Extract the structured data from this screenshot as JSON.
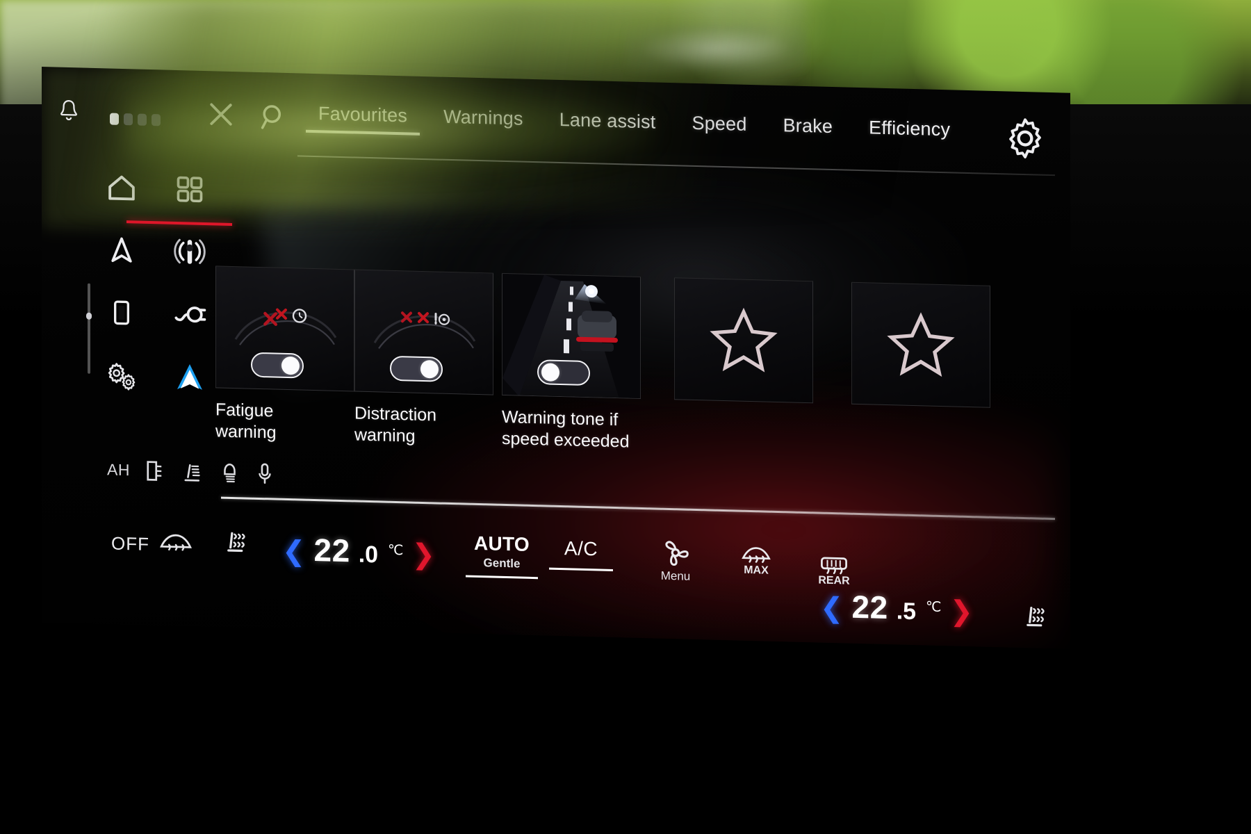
{
  "topbar": {
    "notifications_icon": "bell-icon",
    "pagination": {
      "total": 4,
      "active_index": 0
    },
    "close_label": "close-icon",
    "search_label": "search-icon",
    "settings_label": "gear-icon",
    "tabs": [
      {
        "label": "Favourites",
        "active": true
      },
      {
        "label": "Warnings",
        "active": false
      },
      {
        "label": "Lane assist",
        "active": false
      },
      {
        "label": "Speed",
        "active": false
      },
      {
        "label": "Brake",
        "active": false
      },
      {
        "label": "Efficiency",
        "active": false
      }
    ]
  },
  "sidebar": {
    "items": [
      {
        "name": "home-icon",
        "label": "Home",
        "active": true
      },
      {
        "name": "apps-grid-icon",
        "label": "Apps",
        "active": true
      },
      {
        "name": "navigation-arrow-icon",
        "label": "Navigation",
        "active": false
      },
      {
        "name": "radio-antenna-icon",
        "label": "Radio",
        "active": false
      },
      {
        "name": "phone-icon",
        "label": "Phone",
        "active": false
      },
      {
        "name": "charging-plug-icon",
        "label": "Charging",
        "active": false
      },
      {
        "name": "settings-gears-icon",
        "label": "Settings",
        "active": false
      },
      {
        "name": "maps-navigation-icon",
        "label": "Maps",
        "active": false
      }
    ],
    "accent_color": "#e2142a"
  },
  "status_row": {
    "text": "AH",
    "icons": [
      "door-open-icon",
      "seat-adjust-icon",
      "headrest-icon",
      "microphone-icon"
    ]
  },
  "favourites": {
    "cards": [
      {
        "label": "Fatigue\nwarning",
        "label_line1": "Fatigue",
        "label_line2": "warning",
        "toggle_state": "on",
        "artwork": "driver-fatigue-coffee-icon"
      },
      {
        "label": "Distraction\nwarning",
        "label_line1": "Distraction",
        "label_line2": "warning",
        "toggle_state": "on",
        "artwork": "driver-distraction-icon"
      },
      {
        "label": "Warning tone if\nspeed exceeded",
        "label_line1": "Warning tone if",
        "label_line2": "speed exceeded",
        "toggle_state": "off",
        "artwork": "road-speed-camera-icon"
      }
    ],
    "empty_slots": [
      {
        "icon": "star-outline-icon"
      },
      {
        "icon": "star-outline-icon"
      }
    ]
  },
  "climate": {
    "off_label": "OFF",
    "windscreen_icon": "windscreen-defrost-icon",
    "seat_heat_icon": "seat-heater-icon",
    "left_temp": {
      "integer": "22",
      "decimal": ".0",
      "unit": "℃",
      "dec_left": "❮",
      "dec_right": "❯"
    },
    "right_temp": {
      "integer": "22",
      "decimal": ".5",
      "unit": "℃",
      "dec_left": "❮",
      "dec_right": "❯"
    },
    "auto": {
      "main": "AUTO",
      "sub": "Gentle",
      "active": true
    },
    "ac": {
      "main": "A/C",
      "active": true
    },
    "fan": {
      "icon": "fan-icon",
      "caption": "Menu"
    },
    "max_defrost": {
      "icon": "front-defrost-icon",
      "caption": "MAX"
    },
    "rear_defrost": {
      "icon": "rear-defrost-icon",
      "caption": "REAR"
    },
    "seat_right_icon": "seat-heater-right-icon"
  },
  "colors": {
    "accent_red": "#e2142a",
    "temp_cold": "#2f6bff",
    "temp_hot": "#e0162c",
    "text": "#ffffff",
    "screen_bg": "#050505"
  }
}
